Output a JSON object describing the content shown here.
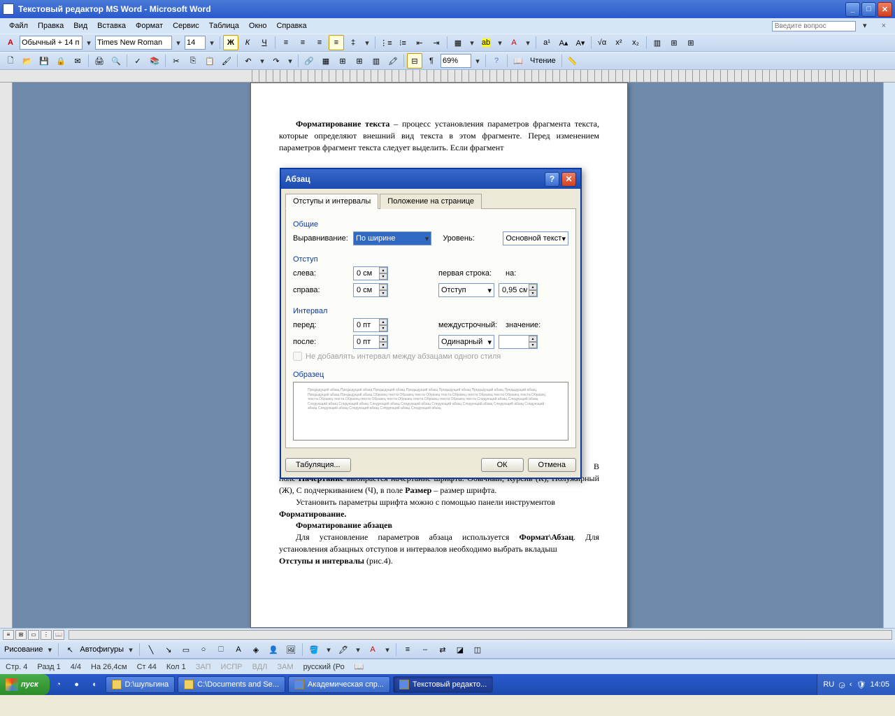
{
  "titlebar": {
    "title": "Текстовый редактор MS Word - Microsoft Word"
  },
  "menubar": {
    "items": [
      "Файл",
      "Правка",
      "Вид",
      "Вставка",
      "Формат",
      "Сервис",
      "Таблица",
      "Окно",
      "Справка"
    ],
    "ask_placeholder": "Введите вопрос"
  },
  "formatting_toolbar": {
    "style": "Обычный + 14 п",
    "font": "Times New Roman",
    "size": "14",
    "zoom": "69%",
    "reading": "Чтение"
  },
  "document": {
    "para1_lead": "Форматирование текста",
    "para1_rest": " – процесс установления параметров фрагмента текста, которые определяют внешний вид текста в этом фрагменте. Перед изменением параметров фрагмент текста следует выделить. Если фрагмент",
    "para2_a": "поле ",
    "para2_b": "Начертание",
    "para2_c": " выбирается начертание шрифта: Обычный, Курсив (К), Полужирный (Ж), С подчеркиванием (Ч), в поле ",
    "para2_d": "Размер",
    "para2_e": " – размер шрифта.",
    "para3": "Установить параметры шрифта можно с помощью панели инструментов ",
    "para3_b": "Форматирование.",
    "para4": "Форматирование абзацев",
    "para5_a": "Для установление параметров абзаца используется ",
    "para5_b": "Формат\\Абзац",
    "para5_c": ". Для установления абзацных отступов и интервалов необходимо выбрать вкладыш ",
    "para5_d": "Отступы и интервалы",
    "para5_e": " (рис.4).",
    "letter_b": "В"
  },
  "dialog": {
    "title": "Абзац",
    "tab1": "Отступы и интервалы",
    "tab2": "Положение на странице",
    "sec_general": "Общие",
    "align_label": "Выравнивание:",
    "align_value": "По ширине",
    "level_label": "Уровень:",
    "level_value": "Основной текст",
    "sec_indent": "Отступ",
    "left_label": "слева:",
    "left_value": "0 см",
    "right_label": "справа:",
    "right_value": "0 см",
    "firstline_label": "первая строка:",
    "firstline_value": "Отступ",
    "by_label": "на:",
    "by_value": "0,95 см",
    "sec_spacing": "Интервал",
    "before_label": "перед:",
    "before_value": "0 пт",
    "after_label": "после:",
    "after_value": "0 пт",
    "line_label": "междустрочный:",
    "line_value": "Одинарный",
    "at_label": "значение:",
    "at_value": "",
    "nospace_label": "Не добавлять интервал между абзацами одного стиля",
    "sec_preview": "Образец",
    "preview_text": "Предыдущий абзац Предыдущий абзац Предыдущий абзац Предыдущий абзац Предыдущий абзац Предыдущий абзац Предыдущий абзац Предыдущий абзац Предыдущий абзац Образец текста Образец текста Образец текста Образец текста Образец текста Образец текста Образец текста Образец текста Образец текста Образец текста Образец текста Образец текста Образец текста Следующий абзац Следующий абзац Следующий абзац Следующий абзац Следующий абзац Следующий абзац Следующий абзац Следующий абзац Следующий абзац Следующий абзац Следующий абзац Следующий абзац Следующий абзац Следующий абзац",
    "btn_tabs": "Табуляция...",
    "btn_ok": "ОК",
    "btn_cancel": "Отмена"
  },
  "drawbar": {
    "draw": "Рисование",
    "autoshapes": "Автофигуры"
  },
  "statusbar": {
    "page": "Стр. 4",
    "sec": "Разд 1",
    "pages": "4/4",
    "at": "На 26,4см",
    "line": "Ст 44",
    "col": "Кол 1",
    "zap": "ЗАП",
    "ispr": "ИСПР",
    "vdl": "ВДЛ",
    "zam": "ЗАМ",
    "lang": "русский (Ро"
  },
  "taskbar": {
    "start": "пуск",
    "tasks": [
      "D:\\шульгина",
      "C:\\Documents and Se...",
      "Академическая спр...",
      "Текстовый редакто..."
    ],
    "lang": "RU",
    "time": "14:05"
  }
}
